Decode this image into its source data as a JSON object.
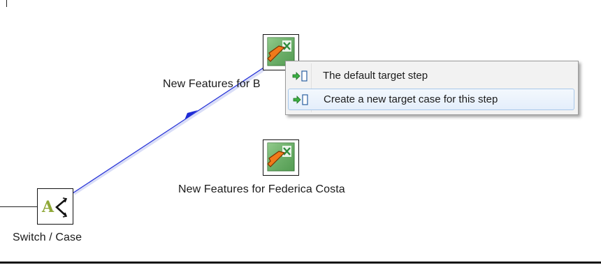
{
  "canvas": {
    "steps": {
      "switch_case": {
        "label": "Switch / Case",
        "icon": "switch-case-icon"
      },
      "target_b": {
        "label": "New Features for B",
        "icon": "excel-output-icon"
      },
      "target_federica": {
        "label": "New Features for Federica Costa",
        "icon": "excel-output-icon"
      }
    },
    "hop_color": "#1e2bd6"
  },
  "context_menu": {
    "items": [
      {
        "label": "The default target step",
        "icon": "target-step-icon",
        "highlighted": false
      },
      {
        "label": "Create a new target case for this step",
        "icon": "target-step-icon",
        "highlighted": true
      }
    ]
  }
}
